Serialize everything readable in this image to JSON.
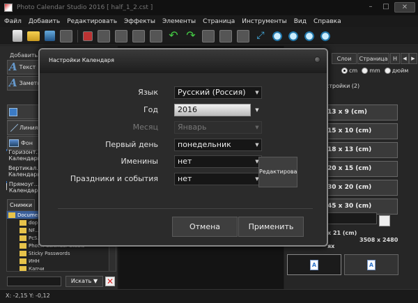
{
  "window": {
    "title": "Photo Calendar Studio 2016 [ half_1_2.cst ]"
  },
  "menu": [
    "Файл",
    "Добавить",
    "Редактировать",
    "Эффекты",
    "Элементы",
    "Страница",
    "Инструменты",
    "Вид",
    "Справка"
  ],
  "left_panel": {
    "header": "Добавить",
    "tools": [
      {
        "label": "Текст"
      },
      {
        "label": "Заметка"
      },
      {
        "label": ""
      },
      {
        "label": ""
      },
      {
        "label": "Линия"
      },
      {
        "label": "Фон"
      }
    ],
    "calendars": [
      {
        "label": "Горизонт... Календарь"
      },
      {
        "label": "Вертикал... Календарь"
      },
      {
        "label": "Прямоуг... Календарь"
      }
    ],
    "snapshots_tab": "Снимки",
    "tree": [
      {
        "label": "Documents",
        "selected": true
      },
      {
        "label": "dop",
        "selected": false
      },
      {
        "label": "NF...",
        "selected": false
      },
      {
        "label": "PcS...",
        "selected": false
      },
      {
        "label": "Phot... Calendar Studio",
        "selected": false
      },
      {
        "label": "Sticky Passwords",
        "selected": false
      },
      {
        "label": "ИНН",
        "selected": false
      },
      {
        "label": "Капчи",
        "selected": false
      }
    ],
    "search_button": "Искать ▼"
  },
  "right_panel": {
    "tabs": [
      "Слои",
      "Страница",
      "Н"
    ],
    "units": [
      {
        "label": "cm",
        "selected": true
      },
      {
        "label": "mm",
        "selected": false
      },
      {
        "label": "дюйм",
        "selected": false
      }
    ],
    "sub_tab": "стройки (2)",
    "sizes": [
      "13 x 9 (cm)",
      "15 x 10 (cm)",
      "18 x 13 (cm)",
      "20 x 15 (cm)",
      "30 x 20 (cm)",
      "45 x 30 (cm)"
    ],
    "size_info": "x 21 (cm)",
    "pixel_info": "3508 x 2480",
    "pixel_unit": "ях"
  },
  "dialog": {
    "title": "Настройки Календаря",
    "fields": [
      {
        "label": "Язык",
        "value": "Русский (Россия)"
      },
      {
        "label": "Год",
        "value": "2016"
      },
      {
        "label": "Месяц",
        "value": "Январь"
      },
      {
        "label": "Первый день",
        "value": "понедельник"
      },
      {
        "label": "Именины",
        "value": "нет"
      },
      {
        "label": "Праздники и события",
        "value": "нет"
      }
    ],
    "edit_button": "Редактировать",
    "cancel_button": "Отмена",
    "apply_button": "Применить"
  },
  "status": {
    "coords": "X: -2,15 Y: -0,12"
  },
  "colors": {
    "background": "#1e1e1e",
    "panel": "#2a2a2a",
    "dialog": "#2b2b2b",
    "selection": "#3a5f9a"
  }
}
